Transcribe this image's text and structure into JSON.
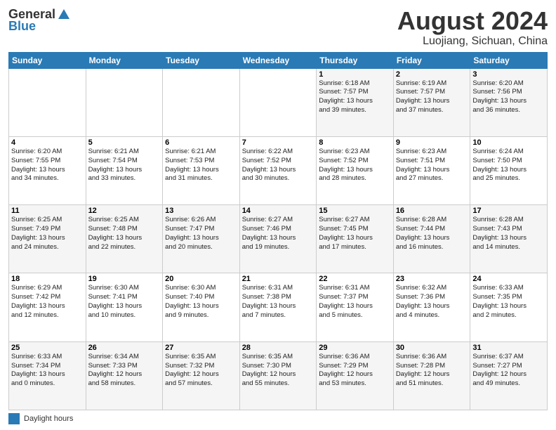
{
  "header": {
    "logo_general": "General",
    "logo_blue": "Blue",
    "month_title": "August 2024",
    "location": "Luojiang, Sichuan, China"
  },
  "days_of_week": [
    "Sunday",
    "Monday",
    "Tuesday",
    "Wednesday",
    "Thursday",
    "Friday",
    "Saturday"
  ],
  "weeks": [
    [
      {
        "day": "",
        "info": ""
      },
      {
        "day": "",
        "info": ""
      },
      {
        "day": "",
        "info": ""
      },
      {
        "day": "",
        "info": ""
      },
      {
        "day": "1",
        "info": "Sunrise: 6:18 AM\nSunset: 7:57 PM\nDaylight: 13 hours\nand 39 minutes."
      },
      {
        "day": "2",
        "info": "Sunrise: 6:19 AM\nSunset: 7:57 PM\nDaylight: 13 hours\nand 37 minutes."
      },
      {
        "day": "3",
        "info": "Sunrise: 6:20 AM\nSunset: 7:56 PM\nDaylight: 13 hours\nand 36 minutes."
      }
    ],
    [
      {
        "day": "4",
        "info": "Sunrise: 6:20 AM\nSunset: 7:55 PM\nDaylight: 13 hours\nand 34 minutes."
      },
      {
        "day": "5",
        "info": "Sunrise: 6:21 AM\nSunset: 7:54 PM\nDaylight: 13 hours\nand 33 minutes."
      },
      {
        "day": "6",
        "info": "Sunrise: 6:21 AM\nSunset: 7:53 PM\nDaylight: 13 hours\nand 31 minutes."
      },
      {
        "day": "7",
        "info": "Sunrise: 6:22 AM\nSunset: 7:52 PM\nDaylight: 13 hours\nand 30 minutes."
      },
      {
        "day": "8",
        "info": "Sunrise: 6:23 AM\nSunset: 7:52 PM\nDaylight: 13 hours\nand 28 minutes."
      },
      {
        "day": "9",
        "info": "Sunrise: 6:23 AM\nSunset: 7:51 PM\nDaylight: 13 hours\nand 27 minutes."
      },
      {
        "day": "10",
        "info": "Sunrise: 6:24 AM\nSunset: 7:50 PM\nDaylight: 13 hours\nand 25 minutes."
      }
    ],
    [
      {
        "day": "11",
        "info": "Sunrise: 6:25 AM\nSunset: 7:49 PM\nDaylight: 13 hours\nand 24 minutes."
      },
      {
        "day": "12",
        "info": "Sunrise: 6:25 AM\nSunset: 7:48 PM\nDaylight: 13 hours\nand 22 minutes."
      },
      {
        "day": "13",
        "info": "Sunrise: 6:26 AM\nSunset: 7:47 PM\nDaylight: 13 hours\nand 20 minutes."
      },
      {
        "day": "14",
        "info": "Sunrise: 6:27 AM\nSunset: 7:46 PM\nDaylight: 13 hours\nand 19 minutes."
      },
      {
        "day": "15",
        "info": "Sunrise: 6:27 AM\nSunset: 7:45 PM\nDaylight: 13 hours\nand 17 minutes."
      },
      {
        "day": "16",
        "info": "Sunrise: 6:28 AM\nSunset: 7:44 PM\nDaylight: 13 hours\nand 16 minutes."
      },
      {
        "day": "17",
        "info": "Sunrise: 6:28 AM\nSunset: 7:43 PM\nDaylight: 13 hours\nand 14 minutes."
      }
    ],
    [
      {
        "day": "18",
        "info": "Sunrise: 6:29 AM\nSunset: 7:42 PM\nDaylight: 13 hours\nand 12 minutes."
      },
      {
        "day": "19",
        "info": "Sunrise: 6:30 AM\nSunset: 7:41 PM\nDaylight: 13 hours\nand 10 minutes."
      },
      {
        "day": "20",
        "info": "Sunrise: 6:30 AM\nSunset: 7:40 PM\nDaylight: 13 hours\nand 9 minutes."
      },
      {
        "day": "21",
        "info": "Sunrise: 6:31 AM\nSunset: 7:38 PM\nDaylight: 13 hours\nand 7 minutes."
      },
      {
        "day": "22",
        "info": "Sunrise: 6:31 AM\nSunset: 7:37 PM\nDaylight: 13 hours\nand 5 minutes."
      },
      {
        "day": "23",
        "info": "Sunrise: 6:32 AM\nSunset: 7:36 PM\nDaylight: 13 hours\nand 4 minutes."
      },
      {
        "day": "24",
        "info": "Sunrise: 6:33 AM\nSunset: 7:35 PM\nDaylight: 13 hours\nand 2 minutes."
      }
    ],
    [
      {
        "day": "25",
        "info": "Sunrise: 6:33 AM\nSunset: 7:34 PM\nDaylight: 13 hours\nand 0 minutes."
      },
      {
        "day": "26",
        "info": "Sunrise: 6:34 AM\nSunset: 7:33 PM\nDaylight: 12 hours\nand 58 minutes."
      },
      {
        "day": "27",
        "info": "Sunrise: 6:35 AM\nSunset: 7:32 PM\nDaylight: 12 hours\nand 57 minutes."
      },
      {
        "day": "28",
        "info": "Sunrise: 6:35 AM\nSunset: 7:30 PM\nDaylight: 12 hours\nand 55 minutes."
      },
      {
        "day": "29",
        "info": "Sunrise: 6:36 AM\nSunset: 7:29 PM\nDaylight: 12 hours\nand 53 minutes."
      },
      {
        "day": "30",
        "info": "Sunrise: 6:36 AM\nSunset: 7:28 PM\nDaylight: 12 hours\nand 51 minutes."
      },
      {
        "day": "31",
        "info": "Sunrise: 6:37 AM\nSunset: 7:27 PM\nDaylight: 12 hours\nand 49 minutes."
      }
    ]
  ],
  "footer": {
    "label": "Daylight hours"
  }
}
